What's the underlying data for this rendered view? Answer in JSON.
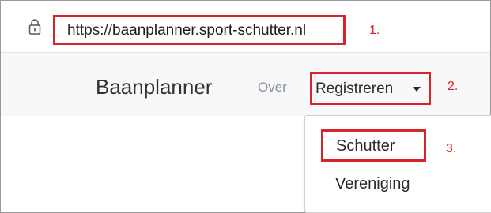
{
  "browser": {
    "url_scheme": "https://",
    "url_host": "baanplanner.sport-schutter.nl",
    "lock_icon": "lock-icon"
  },
  "annotations": {
    "step1": "1.",
    "step2": "2.",
    "step3": "3.",
    "color": "#d8232a"
  },
  "navbar": {
    "brand": "Baanplanner",
    "over": "Over",
    "registreren": "Registreren",
    "caret_icon": "caret-down-icon"
  },
  "dropdown": {
    "items": [
      "Schutter",
      "Vereniging"
    ]
  }
}
